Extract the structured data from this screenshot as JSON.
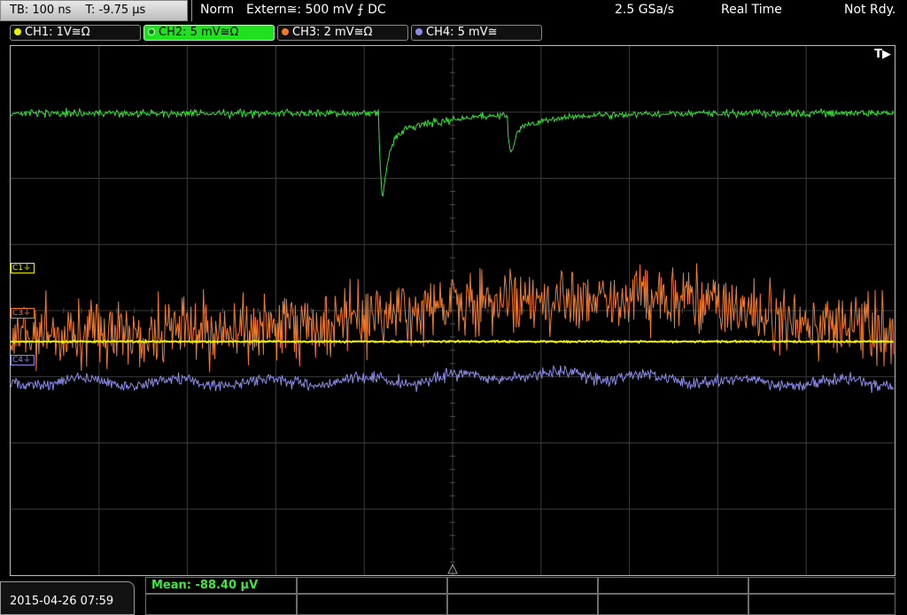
{
  "topbar": {
    "timebase": "TB: 100 ns",
    "trigger_time": "T: -9.75 µs",
    "mode": "Norm",
    "trigger": "Extern≅: 500 mV ⨍ DC",
    "sample_rate": "2.5 GSa/s",
    "acq_mode": "Real Time",
    "status": "Not Rdy."
  },
  "channels": [
    {
      "label": "CH1: 1V≅Ω",
      "color": "#f2f000",
      "marker": "C1",
      "active": false
    },
    {
      "label": "CH2: 5 mV≅Ω",
      "color": "#33e033",
      "marker": "",
      "active": true
    },
    {
      "label": "CH3: 2 mV≅Ω",
      "color": "#f07a2a",
      "marker": "C3",
      "active": false
    },
    {
      "label": "CH4: 5 mV≅",
      "color": "#8a8ae8",
      "marker": "C4",
      "active": false
    }
  ],
  "screen": {
    "trigger_marker": "T▶",
    "h_divisions": 10,
    "v_divisions": 8
  },
  "bottom": {
    "datetime": "2015-04-26 07:59",
    "measurement": "Mean: -88.40 µV"
  }
}
